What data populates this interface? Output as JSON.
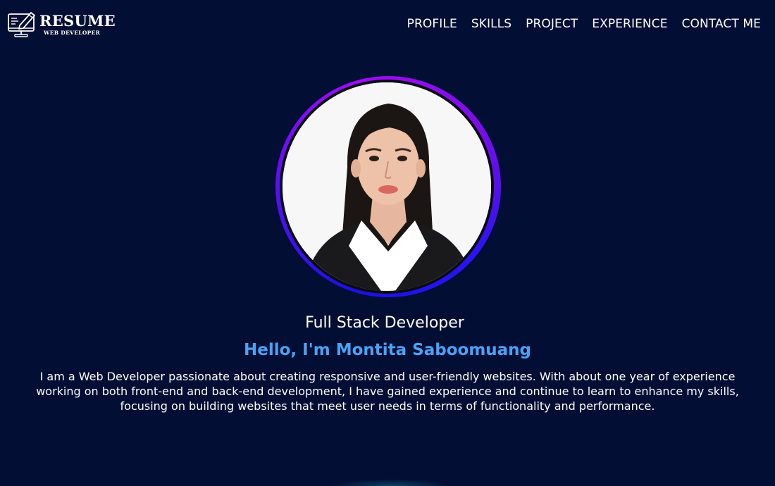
{
  "header": {
    "logo": {
      "title": "RESUME",
      "subtitle": "WEB DEVELOPER",
      "icon": "monitor-pencil-icon"
    },
    "nav": [
      {
        "label": "PROFILE"
      },
      {
        "label": "SKILLS"
      },
      {
        "label": "PROJECT"
      },
      {
        "label": "EXPERIENCE"
      },
      {
        "label": "CONTACT ME"
      }
    ]
  },
  "profile": {
    "photo": "profile-photo",
    "role": "Full Stack Developer",
    "greeting": "Hello, I'm Montita Saboomuang",
    "bio": "I am a Web Developer passionate about creating responsive and user-friendly websites. With about one year of experience working on both front-end and back-end development, I have gained experience and continue to learn to enhance my skills, focusing on building websites that meet user needs in terms of functionality and performance."
  },
  "colors": {
    "background": "#020e33",
    "accent": "#4aa2f6",
    "ring_start": "#1a12e0",
    "ring_end": "#a10cf5"
  }
}
